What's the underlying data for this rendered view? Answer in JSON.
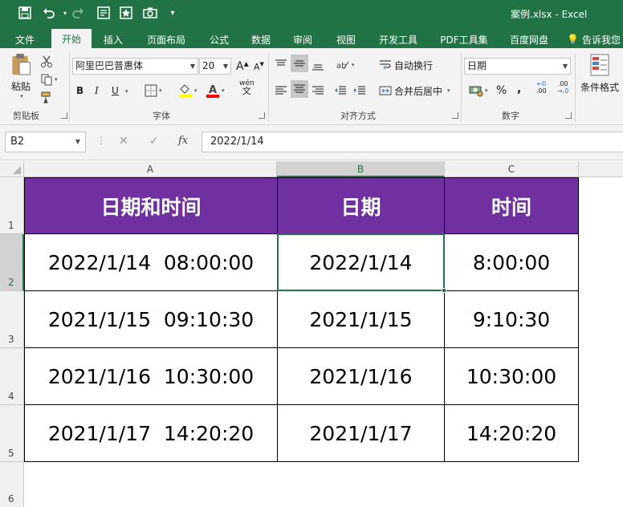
{
  "titlebar": {
    "title": "案例.xlsx  -  Excel",
    "icons": [
      "save-icon",
      "undo-icon",
      "redo-icon",
      "form-icon",
      "star-icon",
      "camera-icon",
      "customize-icon"
    ]
  },
  "tabs": [
    {
      "label": "文件",
      "active": false
    },
    {
      "label": "开始",
      "active": true
    },
    {
      "label": "插入",
      "active": false
    },
    {
      "label": "页面布局",
      "active": false
    },
    {
      "label": "公式",
      "active": false
    },
    {
      "label": "数据",
      "active": false
    },
    {
      "label": "审阅",
      "active": false
    },
    {
      "label": "视图",
      "active": false
    },
    {
      "label": "开发工具",
      "active": false
    },
    {
      "label": "PDF工具集",
      "active": false
    },
    {
      "label": "百度网盘",
      "active": false
    },
    {
      "label": "告诉我您",
      "active": false
    }
  ],
  "ribbon": {
    "clipboard": {
      "paste_label": "粘贴",
      "group": "剪贴板"
    },
    "font": {
      "font_name": "阿里巴巴普惠体",
      "font_size": "20",
      "bold": "B",
      "italic": "I",
      "underline": "U",
      "grow": "A",
      "shrink": "A",
      "phonetic": "wén",
      "group": "字体"
    },
    "alignment": {
      "wrap_text": "自动换行",
      "merge_center": "合并后居中",
      "group": "对齐方式"
    },
    "number": {
      "format": "日期",
      "percent": "%",
      "comma": ",",
      "inc_decimal": ".00",
      "group": "数字"
    },
    "styles": {
      "conditional_format": "条件格式"
    }
  },
  "formula_bar": {
    "name_box": "B2",
    "cancel": "✕",
    "enter": "✓",
    "fx": "fx",
    "formula": "2022/1/14"
  },
  "sheet": {
    "columns": [
      "A",
      "B",
      "C"
    ],
    "rows": [
      "1",
      "2",
      "3",
      "4",
      "5",
      "6"
    ],
    "header": [
      "日期和时间",
      "日期",
      "时间"
    ],
    "data": [
      [
        "2022/1/14  08:00:00",
        "2022/1/14",
        "8:00:00"
      ],
      [
        "2021/1/15  09:10:30",
        "2021/1/15",
        "9:10:30"
      ],
      [
        "2021/1/16  10:30:00",
        "2021/1/16",
        "10:30:00"
      ],
      [
        "2021/1/17  14:20:20",
        "2021/1/17",
        "14:20:20"
      ]
    ],
    "selected_cell": "B2",
    "colors": {
      "header_fill": "#7030a0",
      "header_text": "#ffffff",
      "accent": "#217346"
    }
  }
}
